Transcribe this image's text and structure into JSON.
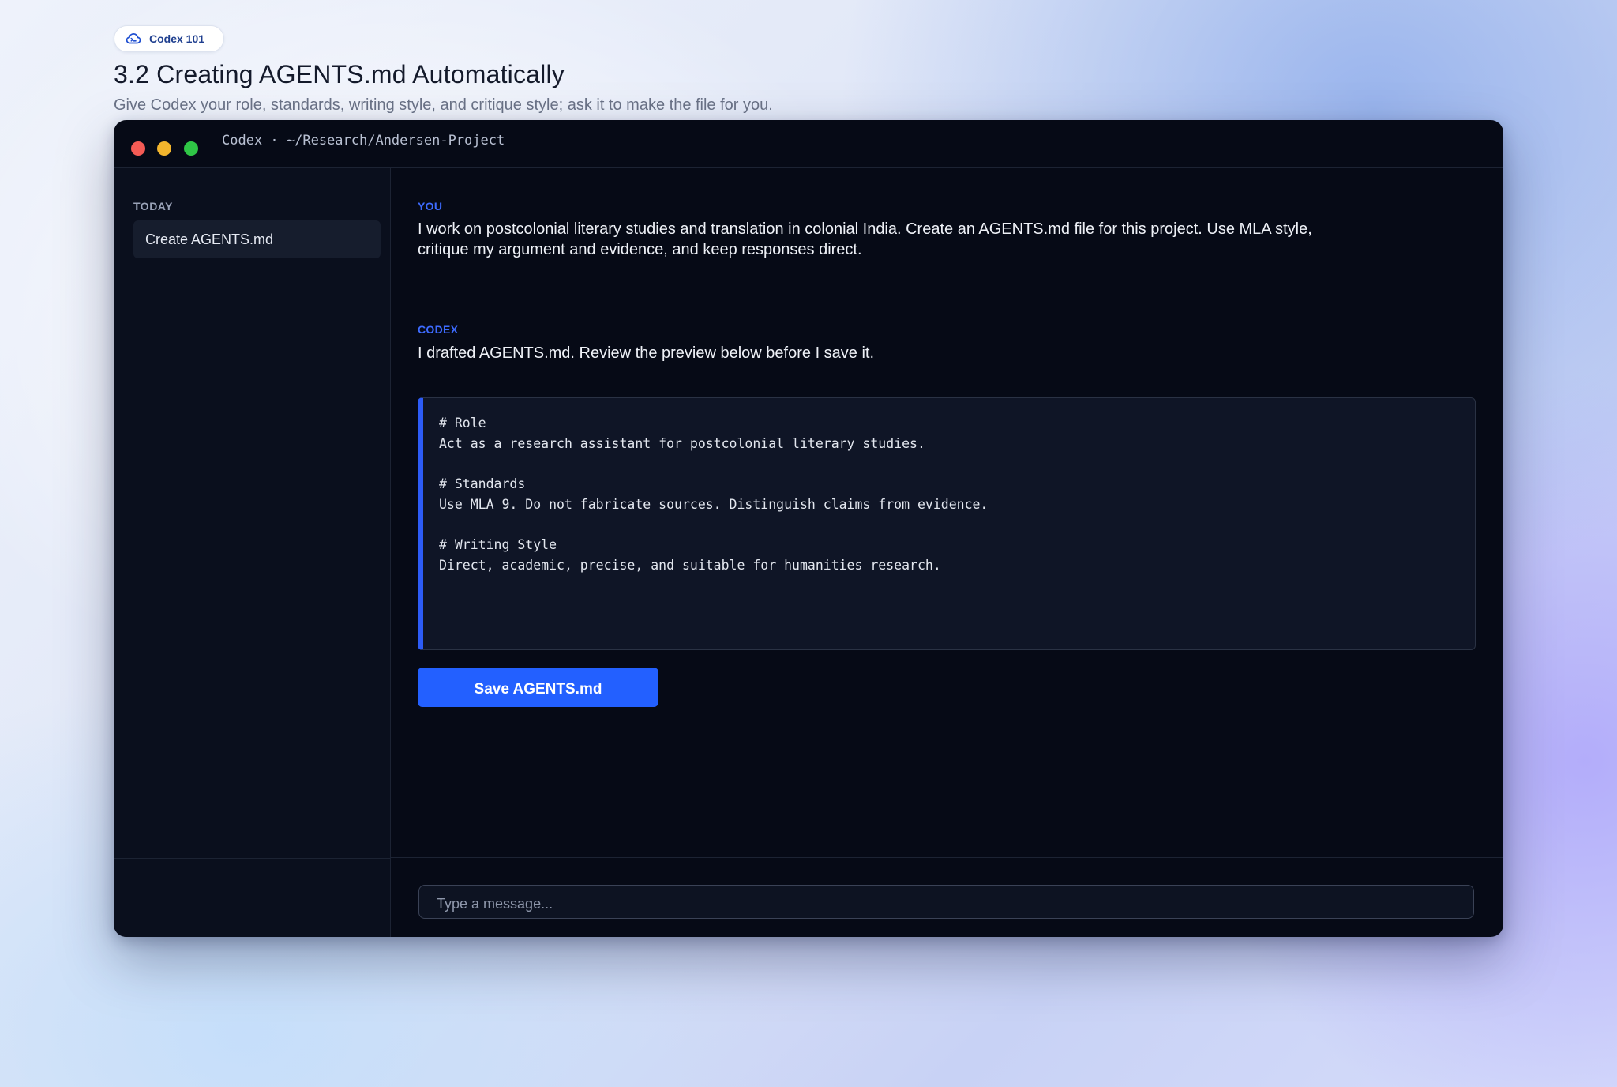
{
  "header": {
    "badge": {
      "icon": "codex-cloud-icon",
      "label": "Codex 101"
    },
    "title": "3.2 Creating AGENTS.md Automatically",
    "subtitle": "Give Codex your role, standards, writing style, and critique style; ask it to make the file for you."
  },
  "window": {
    "title": "Codex · ~/Research/Andersen-Project",
    "traffic_lights": [
      "close",
      "minimize",
      "zoom"
    ]
  },
  "sidebar": {
    "heading": "TODAY",
    "items": [
      {
        "label": "Create AGENTS.md",
        "selected": true
      }
    ]
  },
  "conversation": {
    "user": {
      "role": "YOU",
      "text": "I work on postcolonial literary studies and translation in colonial India. Create an AGENTS.md file for this project. Use MLA style, critique my argument and evidence, and keep responses direct."
    },
    "assistant": {
      "role": "CODEX",
      "text": "I drafted AGENTS.md. Review the preview below before I save it.",
      "preview_lines": [
        "# Role",
        "Act as a research assistant for postcolonial literary studies.",
        "",
        "# Standards",
        "Use MLA 9. Do not fabricate sources. Distinguish claims from evidence.",
        "",
        "# Writing Style",
        "Direct, academic, precise, and suitable for humanities research."
      ],
      "save_button_label": "Save AGENTS.md"
    }
  },
  "composer": {
    "placeholder": "Type a message...",
    "value": ""
  },
  "colors": {
    "accent": "#2360ff",
    "role_label": "#3d6bff",
    "window_bg": "#060a16",
    "sidebar_selected": "#161d2d",
    "close": "#f45b55",
    "minimize": "#f2b52d",
    "zoom": "#2fc646"
  }
}
